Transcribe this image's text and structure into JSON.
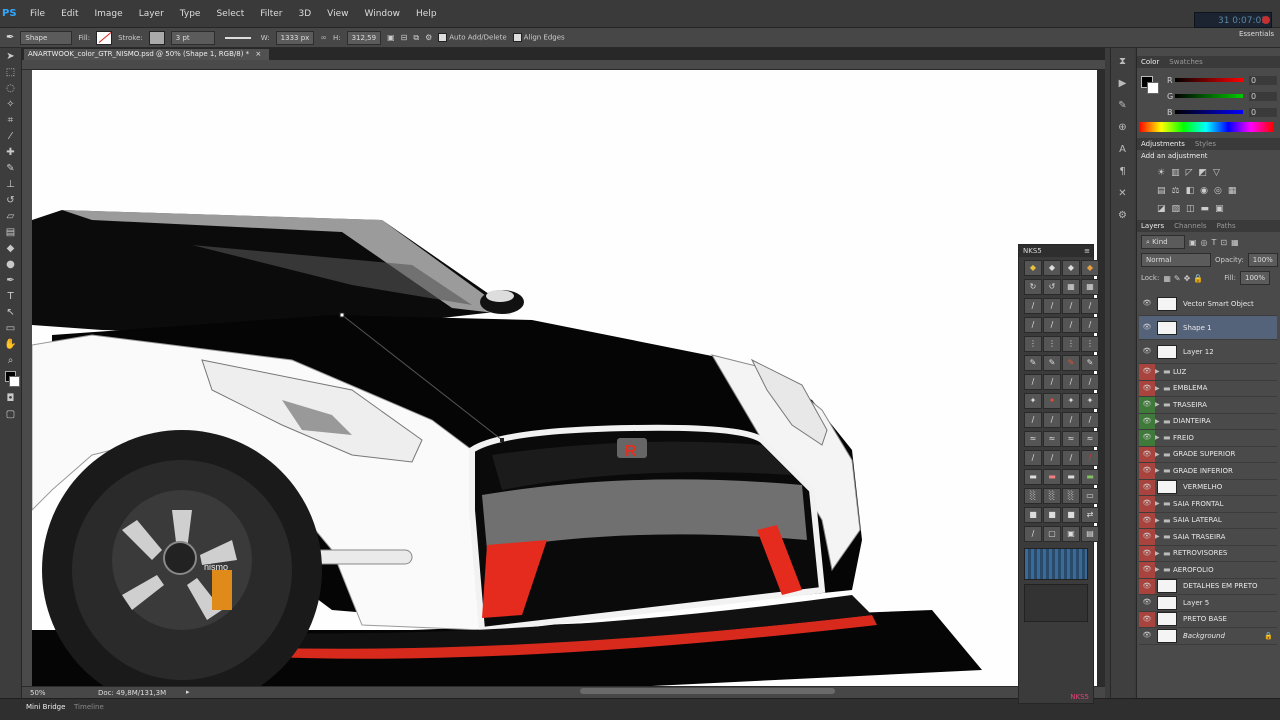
{
  "app": {
    "logo": "PS"
  },
  "menu": [
    "File",
    "Edit",
    "Image",
    "Layer",
    "Type",
    "Select",
    "Filter",
    "3D",
    "View",
    "Window",
    "Help"
  ],
  "clock": {
    "text": "31 0:07:01"
  },
  "options": {
    "tool_mode": "Shape",
    "fill_label": "Fill:",
    "stroke_label": "Stroke:",
    "stroke_size": "3 pt",
    "w_label": "W:",
    "w_value": "1333 px",
    "h_label": "H:",
    "h_value": "312,59",
    "auto_add_delete": "Auto Add/Delete",
    "align_edges": "Align Edges",
    "workspace": "Essentials"
  },
  "document": {
    "tab_title": "ANARTWOOK_color_GTR_NISMO.psd @ 50% (Shape 1, RGB/8) *"
  },
  "status": {
    "zoom": "50%",
    "doc": "Doc: 49,8M/131,3M"
  },
  "bottom_tabs": [
    "Mini Bridge",
    "Timeline"
  ],
  "panels": {
    "color_tabs": [
      "Color",
      "Swatches"
    ],
    "rgb": [
      {
        "ch": "R",
        "value": "0"
      },
      {
        "ch": "G",
        "value": "0"
      },
      {
        "ch": "B",
        "value": "0"
      }
    ],
    "adjustments_tabs": [
      "Adjustments",
      "Styles"
    ],
    "add_adjustment": "Add an adjustment",
    "layers_tabs": [
      "Layers",
      "Channels",
      "Paths"
    ],
    "kind": "Kind",
    "blend_mode": "Normal",
    "opacity_label": "Opacity:",
    "opacity": "100%",
    "lock_label": "Lock:",
    "fill_label": "Fill:",
    "fill": "100%"
  },
  "layers": [
    {
      "name": "Vector Smart Object",
      "eye": "plain",
      "group": false
    },
    {
      "name": "Shape 1",
      "eye": "plain",
      "group": false,
      "selected": true
    },
    {
      "name": "Layer 12",
      "eye": "plain",
      "group": false
    },
    {
      "name": "LUZ",
      "eye": "red",
      "group": true
    },
    {
      "name": "EMBLEMA",
      "eye": "red",
      "group": true
    },
    {
      "name": "TRASEIRA",
      "eye": "green",
      "group": true
    },
    {
      "name": "DIANTEIRA",
      "eye": "green",
      "group": true
    },
    {
      "name": "FREIO",
      "eye": "green",
      "group": true
    },
    {
      "name": "GRADE SUPERIOR",
      "eye": "red",
      "group": true
    },
    {
      "name": "GRADE INFERIOR",
      "eye": "red",
      "group": true
    },
    {
      "name": "VERMELHO",
      "eye": "red",
      "group": false
    },
    {
      "name": "SAIA FRONTAL",
      "eye": "red",
      "group": true
    },
    {
      "name": "SAIA LATERAL",
      "eye": "red",
      "group": true
    },
    {
      "name": "SAIA TRASEIRA",
      "eye": "red",
      "group": true
    },
    {
      "name": "RETROVISORES",
      "eye": "red",
      "group": true
    },
    {
      "name": "AEROFOLIO",
      "eye": "red",
      "group": true
    },
    {
      "name": "DETALHES EM PRETO",
      "eye": "red",
      "group": false
    },
    {
      "name": "Layer 5",
      "eye": "plain",
      "group": false
    },
    {
      "name": "PRETO BASE",
      "eye": "red",
      "group": false
    },
    {
      "name": "Background",
      "eye": "plain",
      "group": false
    }
  ],
  "nks_panel": {
    "title": "NKS5",
    "footer": "NKS5"
  },
  "artwork": {
    "badge": "R",
    "wheel_text": "nismo"
  }
}
